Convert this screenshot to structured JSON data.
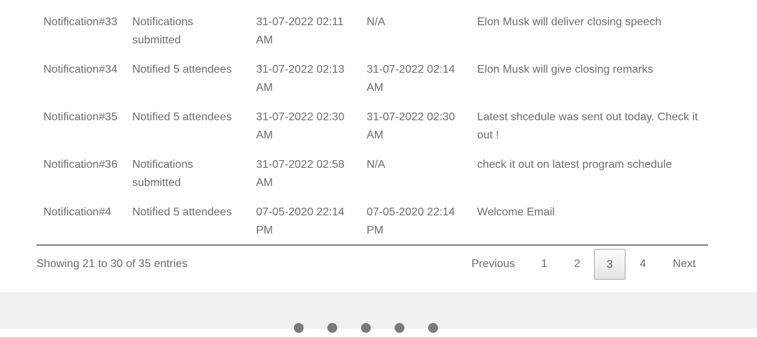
{
  "table": {
    "rows": [
      {
        "id": "Notification#33",
        "status": "Notifications submitted",
        "created": "31-07-2022 02:11 AM",
        "sent": "N/A",
        "message": "Elon Musk will deliver closing speech"
      },
      {
        "id": "Notification#34",
        "status": "Notified 5 attendees",
        "created": "31-07-2022 02:13 AM",
        "sent": "31-07-2022 02:14 AM",
        "message": "Elon Musk will give closing remarks"
      },
      {
        "id": "Notification#35",
        "status": "Notified 5 attendees",
        "created": "31-07-2022 02:30 AM",
        "sent": "31-07-2022 02:30 AM",
        "message": "Latest shcedule was sent out today. Check it out !"
      },
      {
        "id": "Notification#36",
        "status": "Notifications submitted",
        "created": "31-07-2022 02:58 AM",
        "sent": "N/A",
        "message": "check it out on latest program schedule"
      },
      {
        "id": "Notification#4",
        "status": "Notified 5 attendees",
        "created": "07-05-2020 22:14 PM",
        "sent": "07-05-2020 22:14 PM",
        "message": "Welcome Email"
      }
    ]
  },
  "footer_bar": {
    "info": "Showing 21 to 30 of 35 entries"
  },
  "pagination": {
    "previous": "Previous",
    "pages": [
      "1",
      "2",
      "3",
      "4"
    ],
    "current": "3",
    "next": "Next"
  },
  "colors": {
    "text": "#6d6d6d",
    "footer_bg": "#f0f0f0",
    "rule": "#111111"
  },
  "icons": {
    "footer_social": [
      "social-icon-1",
      "social-icon-2",
      "social-icon-3",
      "social-icon-4",
      "social-icon-5"
    ]
  }
}
